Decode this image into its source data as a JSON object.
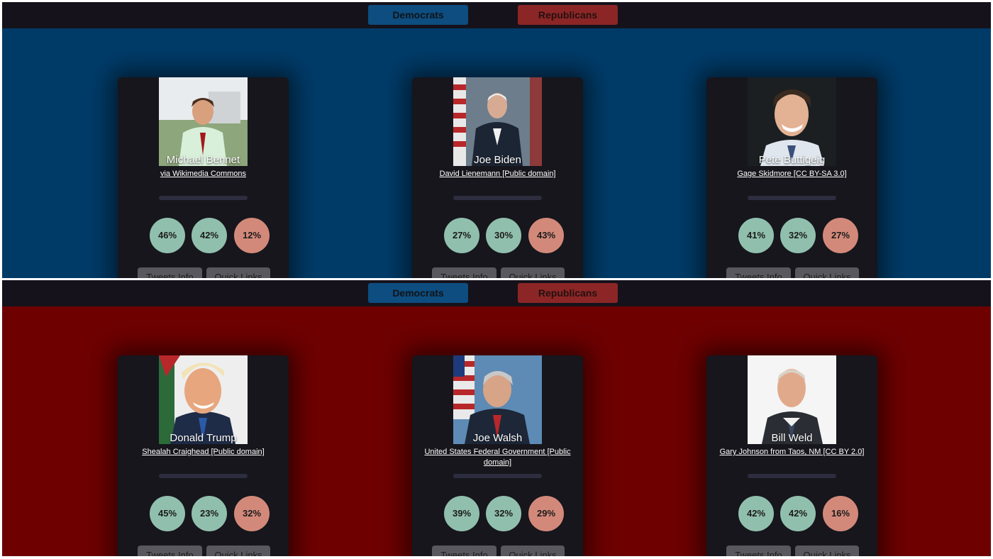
{
  "nav": {
    "democrats_label": "Democrats",
    "republicans_label": "Republicans"
  },
  "card_buttons": {
    "tweets_info": "Tweets Info",
    "quick_links": "Quick Links"
  },
  "colors": {
    "democrat_background": "#003b68",
    "republican_background": "#6e0000",
    "navbar": "#15121b",
    "card": "#16161c",
    "circle_positive": "#91bfae",
    "circle_negative": "#d3897a"
  },
  "democrats": [
    {
      "name": "Michael Bennet",
      "credit": "via Wikimedia Commons",
      "stats": [
        "46%",
        "42%",
        "12%"
      ],
      "photo_icon": "portrait-photo"
    },
    {
      "name": "Joe Biden",
      "credit": "David Lienemann [Public domain]",
      "stats": [
        "27%",
        "30%",
        "43%"
      ],
      "photo_icon": "portrait-photo"
    },
    {
      "name": "Pete Buttigeig",
      "credit": "Gage Skidmore [CC BY-SA 3.0]",
      "stats": [
        "41%",
        "32%",
        "27%"
      ],
      "photo_icon": "portrait-photo"
    }
  ],
  "republicans": [
    {
      "name": "Donald Trump",
      "credit": "Shealah Craighead [Public domain]",
      "stats": [
        "45%",
        "23%",
        "32%"
      ],
      "photo_icon": "portrait-photo"
    },
    {
      "name": "Joe Walsh",
      "credit": "United States Federal Government [Public domain]",
      "stats": [
        "39%",
        "32%",
        "29%"
      ],
      "photo_icon": "portrait-photo"
    },
    {
      "name": "Bill Weld",
      "credit": "Gary Johnson from Taos, NM [CC BY 2.0]",
      "stats": [
        "42%",
        "42%",
        "16%"
      ],
      "photo_icon": "portrait-photo"
    }
  ]
}
